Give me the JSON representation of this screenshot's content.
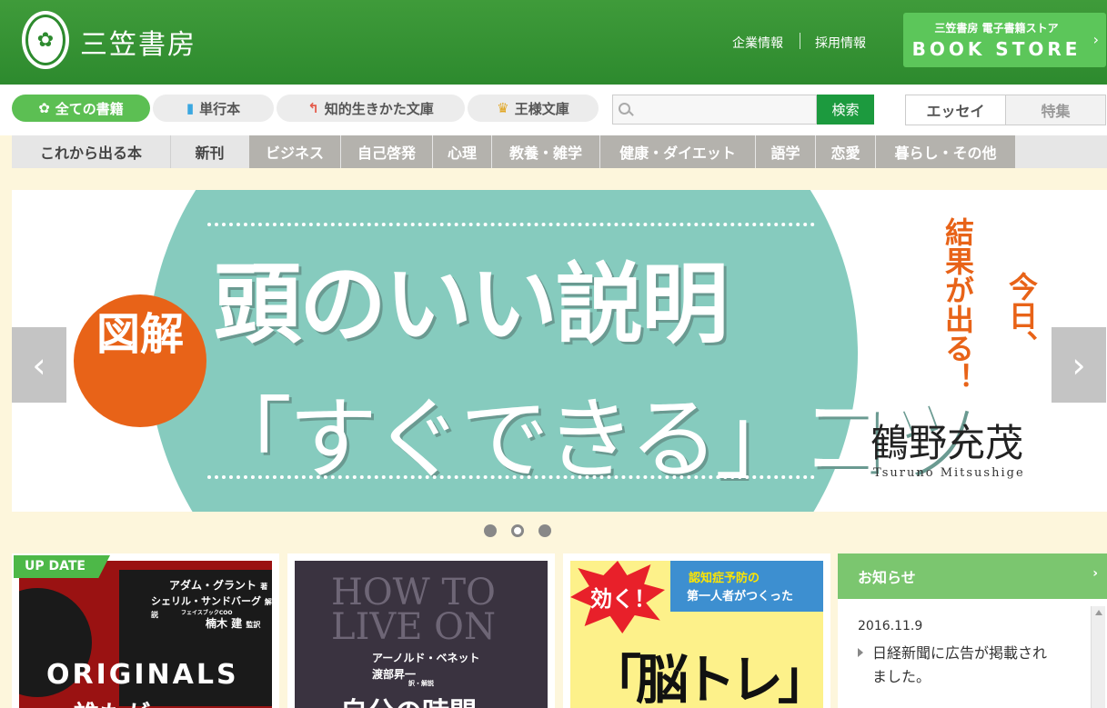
{
  "header": {
    "logo_text": "三笠書房",
    "logo_icon": "emblem-icon",
    "links": [
      "企業情報",
      "採用情報"
    ],
    "bookstore": {
      "line1": "三笠書房 電子書籍ストア",
      "line2": "BOOK STORE",
      "chevron": "›"
    }
  },
  "tabs": [
    {
      "label": "全ての書籍",
      "icon": "✿"
    },
    {
      "label": "単行本",
      "icon": "▮"
    },
    {
      "label": "知的生きかた文庫",
      "icon": "↰"
    },
    {
      "label": "王様文庫",
      "icon": "♛"
    }
  ],
  "search": {
    "placeholder": "",
    "button": "検索"
  },
  "right_tabs": [
    "エッセイ",
    "特集"
  ],
  "categories": [
    "これから出る本",
    "新刊",
    "ビジネス",
    "自己啓発",
    "心理",
    "教養・雑学",
    "健康・ダイエット",
    "語学",
    "恋愛",
    "暮らし・その他"
  ],
  "banner": {
    "badge": "図解",
    "title1": "頭のいい説明",
    "title2": "「すぐできる」コツ",
    "tagline1": "結果が出る！",
    "tagline2": "今日、",
    "author": "鶴野充茂",
    "author_en": "Tsuruno Mitsushige",
    "prev": "‹",
    "next": "›"
  },
  "slides": {
    "count": 3,
    "active": 1
  },
  "cards": {
    "update_badge": "UP DATE",
    "book1": {
      "author": "アダム・グラント",
      "author_suffix": "著",
      "commentary": "シェリル・サンドバーグ",
      "commentary_suffix": "解説",
      "commentary_role": "フェイスブックCOO",
      "translator": "楠木 建",
      "translator_suffix": "監訳",
      "title": "ORIGINALS",
      "subtitle": "誰もが"
    },
    "book2": {
      "eng_title_1": "HOW TO",
      "eng_title_2": "LIVE ON",
      "author": "アーノルド・ベネット",
      "translator": "渡部昇一",
      "translator_role": "訳・解説",
      "title": "自分の時間"
    },
    "book3": {
      "burst": "効く！",
      "tagline1": "認知症予防の",
      "tagline2": "第一人者がつくった",
      "title": "「脳トレ」"
    }
  },
  "news": {
    "heading": "お知らせ",
    "chevron": "›",
    "date": "2016.11.9",
    "item": "日経新聞に広告が掲載されました。"
  }
}
